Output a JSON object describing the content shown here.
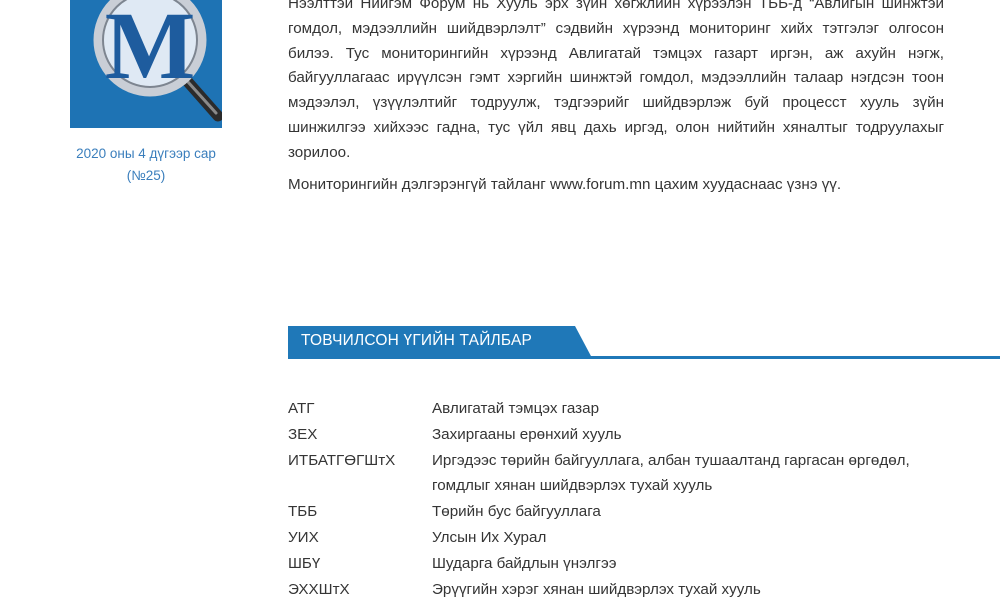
{
  "sidebar": {
    "issue_date": "2020 оны 4 дүгээр сар",
    "issue_number": "(№25)"
  },
  "intro": {
    "paragraphs": [
      "Нээлттэй Нийгэм Форум нь Хууль эрх зүйн хөгжлийн хүрээлэн ТББ-д “Авлигын шинжтэй гомдол, мэдээллийн шийдвэрлэлт” сэдвийн хүрээнд мониторинг хийх тэтгэлэг олгосон билээ. Тус мониторингийн хүрээнд Авлигатай тэмцэх газарт иргэн, аж ахуйн нэгж, байгууллагаас ирүүлсэн гэмт хэргийн шинжтэй гомдол, мэдээллийн талаар нэгдсэн тоон мэдээлэл, үзүүлэлтийг тодруулж, тэдгээрийг шийдвэрлэж буй процесст хууль зүйн шинжилгээ хийхээс гадна, тус үйл явц дахь иргэд, олон нийтийн хяналтыг тодруулахыг зорилоо.",
      "Мониторингийн дэлгэрэнгүй тайланг www.forum.mn цахим хуудаснаас үзнэ үү."
    ]
  },
  "section": {
    "heading": "ТОВЧИЛСОН ҮГИЙН ТАЙЛБАР"
  },
  "abbreviations": [
    {
      "term": "АТГ",
      "definition": "Авлигатай тэмцэх газар"
    },
    {
      "term": "ЗЕХ",
      "definition": "Захиргааны ерөнхий хууль"
    },
    {
      "term": "ИТБАТГӨГШтХ",
      "definition": "Иргэдээс төрийн байгууллага, албан тушаалтанд гаргасан өргөдөл, гомдлыг хянан шийдвэрлэх тухай хууль"
    },
    {
      "term": "ТББ",
      "definition": "Төрийн бус байгууллага"
    },
    {
      "term": "УИХ",
      "definition": "Улсын Их Хурал"
    },
    {
      "term": "ШБҮ",
      "definition": "Шударга байдлын үнэлгээ"
    },
    {
      "term": "ЭХХШтХ",
      "definition": "Эрүүгийн хэрэг хянан шийдвэрлэх тухай хууль"
    }
  ],
  "colors": {
    "accent": "#1f78b8",
    "logo_bg": "#1e73b4",
    "date_text": "#3a7ebc"
  },
  "icons": {
    "logo": "magnifier-m-logo"
  }
}
